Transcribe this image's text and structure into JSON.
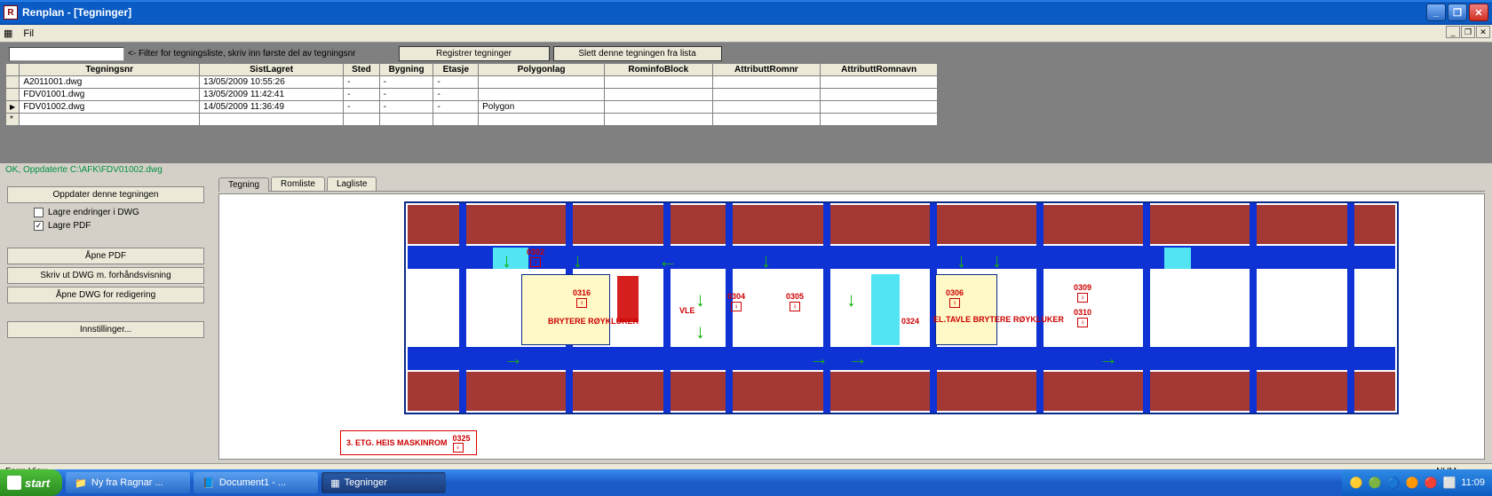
{
  "window": {
    "title": "Renplan - [Tegninger]",
    "menu": {
      "file": "Fil"
    }
  },
  "filter": {
    "hint": "<- Filter for tegningsliste, skriv inn første del av tegningsnr",
    "btn_register": "Registrer tegninger",
    "btn_delete": "Slett denne tegningen fra lista"
  },
  "grid": {
    "headers": [
      "Tegningsnr",
      "SistLagret",
      "Sted",
      "Bygning",
      "Etasje",
      "Polygonlag",
      "RominfoBlock",
      "AttributtRomnr",
      "AttributtRomnavn"
    ],
    "rows": [
      {
        "sel": "",
        "nr": "A2011001.dwg",
        "lag": "13/05/2009 10:55:26",
        "sted": "-",
        "byg": "-",
        "et": "-",
        "poly": "",
        "rb": "",
        "ar": "",
        "an": ""
      },
      {
        "sel": "",
        "nr": "FDV01001.dwg",
        "lag": "13/05/2009 11:42:41",
        "sted": "-",
        "byg": "-",
        "et": "-",
        "poly": "",
        "rb": "",
        "ar": "",
        "an": ""
      },
      {
        "sel": "cur",
        "nr": "FDV01002.dwg",
        "lag": "14/05/2009 11:36:49",
        "sted": "-",
        "byg": "-",
        "et": "-",
        "poly": "Polygon",
        "rb": "",
        "ar": "",
        "an": ""
      }
    ]
  },
  "status_msg": "OK, Oppdaterte C:\\AFK\\FDV01002.dwg",
  "sidebar": {
    "btn_update": "Oppdater denne tegningen",
    "chk_save_dwg": "Lagre endringer i DWG",
    "chk_save_pdf": "Lagre PDF",
    "btn_open_pdf": "Åpne PDF",
    "btn_print": "Skriv ut  DWG  m. forhåndsvisning",
    "btn_edit": "Åpne DWG for redigering",
    "btn_settings": "Innstillinger..."
  },
  "tabs": {
    "t1": "Tegning",
    "t2": "Romliste",
    "t3": "Lagliste"
  },
  "plan": {
    "rooms": {
      "r0302": "0302",
      "r0316": "0316",
      "r0304": "0304",
      "r0305": "0305",
      "r0306": "0306",
      "r0309": "0309",
      "r0310": "0310",
      "r0324": "0324"
    },
    "labels": {
      "brytere": "BRYTERE RØYKLUKER",
      "vle": "VLE",
      "eltavle": "EL.TAVLE BRYTERE RØYKLUKER"
    },
    "legend": "3. ETG. HEIS MASKINROM",
    "legend_room": "0325"
  },
  "statusbar": {
    "text": "Form View",
    "num": "NUM"
  },
  "taskbar": {
    "start": "start",
    "items": [
      {
        "label": "Ny fra Ragnar ...",
        "icon": "📁"
      },
      {
        "label": "Document1 - ...",
        "icon": "📘"
      },
      {
        "label": "Tegninger",
        "icon": "▦",
        "active": true
      }
    ],
    "clock": "11:09"
  }
}
